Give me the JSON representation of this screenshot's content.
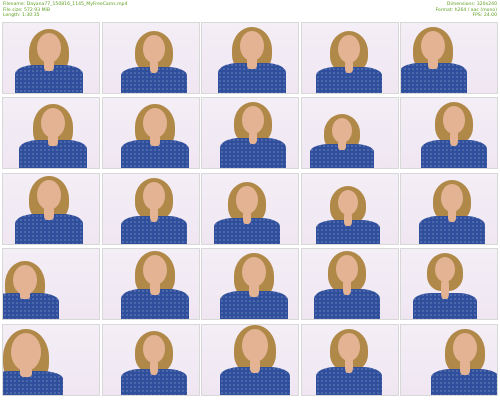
{
  "meta_left": {
    "filename": "Filename: Dayana77_150816_1145_MyFreeCams.mp4",
    "filesize": "File size: 572.93 MiB",
    "length": "Length: 1:30:35"
  },
  "meta_right": {
    "dimensions": "Dimensions: 320x240",
    "format": "Format: h264 / aac (mono)",
    "fps": "FPS: 24.00"
  },
  "colors": {
    "meta_text": "#5c9e1e",
    "background_wall": "#efe6f1",
    "shirt_blue": "#2f4f9c",
    "hair": "#b08848",
    "skin": "#e3b393"
  },
  "thumbnails": [
    {
      "label": "thumbnail-1"
    },
    {
      "label": "thumbnail-2"
    },
    {
      "label": "thumbnail-3"
    },
    {
      "label": "thumbnail-4"
    },
    {
      "label": "thumbnail-5"
    },
    {
      "label": "thumbnail-6"
    },
    {
      "label": "thumbnail-7"
    },
    {
      "label": "thumbnail-8"
    },
    {
      "label": "thumbnail-9"
    },
    {
      "label": "thumbnail-10"
    },
    {
      "label": "thumbnail-11"
    },
    {
      "label": "thumbnail-12"
    },
    {
      "label": "thumbnail-13"
    },
    {
      "label": "thumbnail-14"
    },
    {
      "label": "thumbnail-15"
    },
    {
      "label": "thumbnail-16"
    },
    {
      "label": "thumbnail-17"
    },
    {
      "label": "thumbnail-18"
    },
    {
      "label": "thumbnail-19"
    },
    {
      "label": "thumbnail-20"
    },
    {
      "label": "thumbnail-21"
    },
    {
      "label": "thumbnail-22"
    },
    {
      "label": "thumbnail-23"
    },
    {
      "label": "thumbnail-24"
    },
    {
      "label": "thumbnail-25"
    }
  ]
}
